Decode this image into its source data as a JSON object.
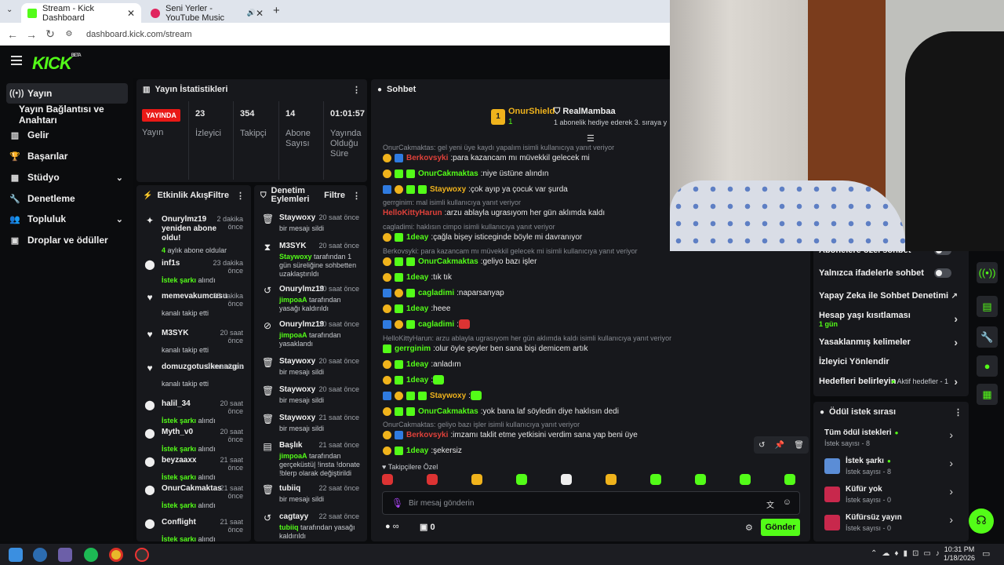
{
  "browser": {
    "tabs": [
      {
        "title": "Stream - Kick Dashboard",
        "active": true
      },
      {
        "title": "Seni Yerler - YouTube Music",
        "active": false
      }
    ],
    "url": "dashboard.kick.com/stream",
    "new_tab": "+"
  },
  "logo": {
    "text": "KICK",
    "sup": "BETA"
  },
  "sidebar": {
    "items": [
      {
        "label": "Yayın",
        "icon": "broadcast-icon",
        "active": true
      },
      {
        "label": "Yayın Bağlantısı ve Anahtarı",
        "icon": "",
        "active": false
      },
      {
        "label": "Gelir",
        "icon": "chart-icon"
      },
      {
        "label": "Başarılar",
        "icon": "trophy-icon"
      },
      {
        "label": "Stüdyo",
        "icon": "grid-icon",
        "chevron": "⌄"
      },
      {
        "label": "Denetleme",
        "icon": "wrench-icon"
      },
      {
        "label": "Topluluk",
        "icon": "people-icon",
        "chevron": "⌄"
      },
      {
        "label": "Droplar ve ödüller",
        "icon": "gift-icon"
      }
    ]
  },
  "stats": {
    "title": "Yayın İstatistikleri",
    "live_badge": "YAYINDA",
    "live_label": "Yayın",
    "cols": [
      {
        "value": "23",
        "label": "İzleyici"
      },
      {
        "value": "354",
        "label": "Takipçi"
      },
      {
        "value": "14",
        "label": "Abone Sayısı"
      },
      {
        "value": "01:01:57",
        "label": "Yayında Olduğu Süre"
      }
    ]
  },
  "activity": {
    "title": "Etkinlik Akışı",
    "filter": "Filtre",
    "items": [
      {
        "user": "Onurylmz19 yeniden abone oldu!",
        "time": "2 dakika önce",
        "sub_green": "4",
        "sub": " aylık abone oldular",
        "icon": "✦"
      },
      {
        "user": "inf1s",
        "time": "23 dakika önce",
        "sub_green": "İstek şarkı",
        "sub": " alındı",
        "icon": "⬤"
      },
      {
        "user": "memevakumcusu",
        "time": "38 dakika önce",
        "sub_green": "",
        "sub": "kanalı takip etti",
        "icon": "♥"
      },
      {
        "user": "M3SYK",
        "time": "20 saat önce",
        "sub_green": "",
        "sub": "kanalı takip etti",
        "icon": "♥"
      },
      {
        "user": "domuzgotusikenazgin",
        "time": "2 saat önce",
        "sub_green": "",
        "sub": "kanalı takip etti",
        "icon": "♥"
      },
      {
        "user": "halil_34",
        "time": "20 saat önce",
        "sub_green": "İstek şarkı",
        "sub": " alındı",
        "icon": "⬤"
      },
      {
        "user": "Myth_v0",
        "time": "20 saat önce",
        "sub_green": "İstek şarkı",
        "sub": " alındı",
        "icon": "⬤"
      },
      {
        "user": "beyzaaxx",
        "time": "21 saat önce",
        "sub_green": "İstek şarkı",
        "sub": " alındı",
        "icon": "⬤"
      },
      {
        "user": "OnurCakmaktas",
        "time": "21 saat önce",
        "sub_green": "İstek şarkı",
        "sub": " alındı",
        "icon": "⬤"
      },
      {
        "user": "Conflight",
        "time": "21 saat önce",
        "sub_green": "İstek şarkı",
        "sub": " alındı",
        "icon": "⬤"
      }
    ]
  },
  "modlog": {
    "title": "Denetim Eylemleri",
    "filter": "Filtre",
    "items": [
      {
        "user": "Staywoxy",
        "time": "20 saat önce",
        "pre": "",
        "green": "",
        "sub": "bir mesajı sildi",
        "icon": "🗑"
      },
      {
        "user": "M3SYK",
        "time": "20 saat önce",
        "pre": "",
        "green": "Staywoxy",
        "sub": " tarafından 1 gün süreliğine sohbetten uzaklaştırıldı",
        "icon": "⧗"
      },
      {
        "user": "Onurylmz19",
        "time": "20 saat önce",
        "pre": "",
        "green": "jimpoaA",
        "sub": " tarafından yasağı kaldırıldı",
        "icon": "↺"
      },
      {
        "user": "Onurylmz19",
        "time": "20 saat önce",
        "pre": "",
        "green": "jimpoaA",
        "sub": " tarafından yasaklandı",
        "icon": "⊘"
      },
      {
        "user": "Staywoxy",
        "time": "20 saat önce",
        "pre": "",
        "green": "",
        "sub": "bir mesajı sildi",
        "icon": "🗑"
      },
      {
        "user": "Staywoxy",
        "time": "20 saat önce",
        "pre": "",
        "green": "",
        "sub": "bir mesajı sildi",
        "icon": "🗑"
      },
      {
        "user": "Staywoxy",
        "time": "21 saat önce",
        "pre": "",
        "green": "",
        "sub": "bir mesajı sildi",
        "icon": "🗑"
      },
      {
        "user": "Başlık",
        "time": "21 saat önce",
        "pre": "",
        "green": "jimpoaA",
        "sub": " tarafından gerçeküstü| !insta !donate !blerp olarak değiştirildi",
        "icon": "▤"
      },
      {
        "user": "tubiiq",
        "time": "22 saat önce",
        "pre": "",
        "green": "",
        "sub": "bir mesajı sildi",
        "icon": "🗑"
      },
      {
        "user": "cagtayy",
        "time": "22 saat önce",
        "pre": "",
        "green": "tubiiq",
        "sub": " tarafından yasağı kaldırıldı",
        "icon": "↺"
      }
    ]
  },
  "chat": {
    "title": "Sohbet",
    "pinned": [
      {
        "name": "OnurShield",
        "value": "1"
      },
      {
        "name": "RealMambaa",
        "note": "1 abonelik hediye ederek 3. sıraya y"
      }
    ],
    "messages": [
      {
        "reply": "OnurCakmaktas: gel yeni üye kaydı yapalım isimli kullanıcıya yanıt veriyor"
      },
      {
        "badges": [
          "gold",
          "blu"
        ],
        "name": "Berkovsyki",
        "color": "#e0413a",
        "text": "para kazancam mı müvekkil gelecek mi"
      },
      {
        "badges": [
          "gold",
          "grn",
          "grn"
        ],
        "name": "OnurCakmaktas",
        "color": "#53fc18",
        "text": "niye üstüne alındın"
      },
      {
        "badges": [
          "blu",
          "gold",
          "grn",
          "grn"
        ],
        "name": "Staywoxy",
        "color": "#f0b31c",
        "text": "çok ayıp ya çocuk var şurda"
      },
      {
        "reply": "gerrginim: mal isimli kullanıcıya yanıt veriyor"
      },
      {
        "badges": [],
        "name": "HelloKittyHarun",
        "color": "#e0413a",
        "text": "arzu ablayla ugrasıyom her gün aklımda kaldı"
      },
      {
        "reply": "cagladimi: haklısın cimpo isimli kullanıcıya yanıt veriyor"
      },
      {
        "badges": [
          "gold",
          "grn"
        ],
        "name": "1deay",
        "color": "#53fc18",
        "text": "çağla bişey isticeginde böyle mi davranıyor"
      },
      {
        "reply": "Berkovsyki: para kazancam mı müvekkil gelecek mi isimli kullanıcıya yanıt veriyor"
      },
      {
        "badges": [
          "gold",
          "grn",
          "grn"
        ],
        "name": "OnurCakmaktas",
        "color": "#53fc18",
        "text": "geliyo bazı işler"
      },
      {
        "badges": [
          "gold",
          "grn"
        ],
        "name": "1deay",
        "color": "#53fc18",
        "text": "tık tık"
      },
      {
        "badges": [
          "blu",
          "gold",
          "grn"
        ],
        "name": "cagladimi",
        "color": "#53fc18",
        "text": "naparsanyap"
      },
      {
        "badges": [
          "gold",
          "grn"
        ],
        "name": "1deay",
        "color": "#53fc18",
        "text": "heee"
      },
      {
        "badges": [
          "blu",
          "gold",
          "grn"
        ],
        "name": "cagladimi",
        "color": "#53fc18",
        "text": "",
        "emote": "red"
      },
      {
        "reply": "HelloKittyHarun: arzu ablayla ugrasıyom her gün aklımda kaldı isimli kullanıcıya yanıt veriyor"
      },
      {
        "badges": [
          "grn"
        ],
        "name": "gerrginim",
        "color": "#53fc18",
        "text": "olur öyle şeyler ben sana bişi demicem artık"
      },
      {
        "badges": [
          "gold",
          "grn"
        ],
        "name": "1deay",
        "color": "#53fc18",
        "text": "anladım"
      },
      {
        "badges": [
          "gold",
          "grn"
        ],
        "name": "1deay",
        "color": "#53fc18",
        "text": "",
        "emote": "green"
      },
      {
        "badges": [
          "blu",
          "gold",
          "grn",
          "grn"
        ],
        "name": "Staywoxy",
        "color": "#f0b31c",
        "text": "",
        "emote": "green"
      },
      {
        "badges": [
          "gold",
          "grn",
          "grn"
        ],
        "name": "OnurCakmaktas",
        "color": "#53fc18",
        "text": "yok bana laf söyledin diye haklısın dedi"
      },
      {
        "reply": "OnurCakmaktas: geliyo bazı işler isimli kullanıcıya yanıt veriyor"
      },
      {
        "badges": [
          "gold",
          "blu"
        ],
        "name": "Berkovsyki",
        "color": "#e0413a",
        "text": "imzamı taklit etme yetkisini verdim sana yap beni üye"
      },
      {
        "badges": [
          "gold",
          "grn"
        ],
        "name": "1deay",
        "color": "#53fc18",
        "text": "şekersiz"
      }
    ],
    "followers_only": "Takipçilere Özel",
    "input_placeholder": "Bir mesaj gönderin",
    "points": "∞",
    "count": "0",
    "send_label": "Gönder"
  },
  "settings": {
    "rows": [
      {
        "label": "Abonelere özel sohbet",
        "type": "toggle"
      },
      {
        "label": "Yalnızca ifadelerle sohbet",
        "type": "toggle"
      },
      {
        "label": "Yapay Zeka ile Sohbet Denetimi",
        "type": "ext"
      },
      {
        "label": "Hesap yaşı kısıtlaması",
        "sub": "1 gün",
        "type": "chev"
      },
      {
        "label": "Yasaklanmış kelimeler",
        "type": "chev"
      },
      {
        "label": "İzleyici Yönlendir",
        "type": "none"
      },
      {
        "label": "Hedefleri belirleyin",
        "note": "Aktif hedefler - 1",
        "type": "chev"
      }
    ]
  },
  "rewards": {
    "title": "Ödül istek sırası",
    "items": [
      {
        "title": "Tüm ödül istekleri",
        "sub": "İstek sayısı - 8",
        "dot": true
      },
      {
        "title": "İstek şarkı",
        "sub": "İstek sayısı - 8",
        "dot": true,
        "color": "#5b8dd6"
      },
      {
        "title": "Küfür yok",
        "sub": "İstek sayısı - 0",
        "dot": false,
        "color": "#c8284c"
      },
      {
        "title": "Küfürsüz yayın",
        "sub": "İstek sayısı - 0",
        "dot": false,
        "color": "#c8284c"
      }
    ]
  },
  "taskbar": {
    "time": "10:31 PM",
    "date": "1/18/2026"
  },
  "colors": {
    "accent": "#53fc18",
    "live": "#e91916",
    "panel": "#17181c"
  }
}
